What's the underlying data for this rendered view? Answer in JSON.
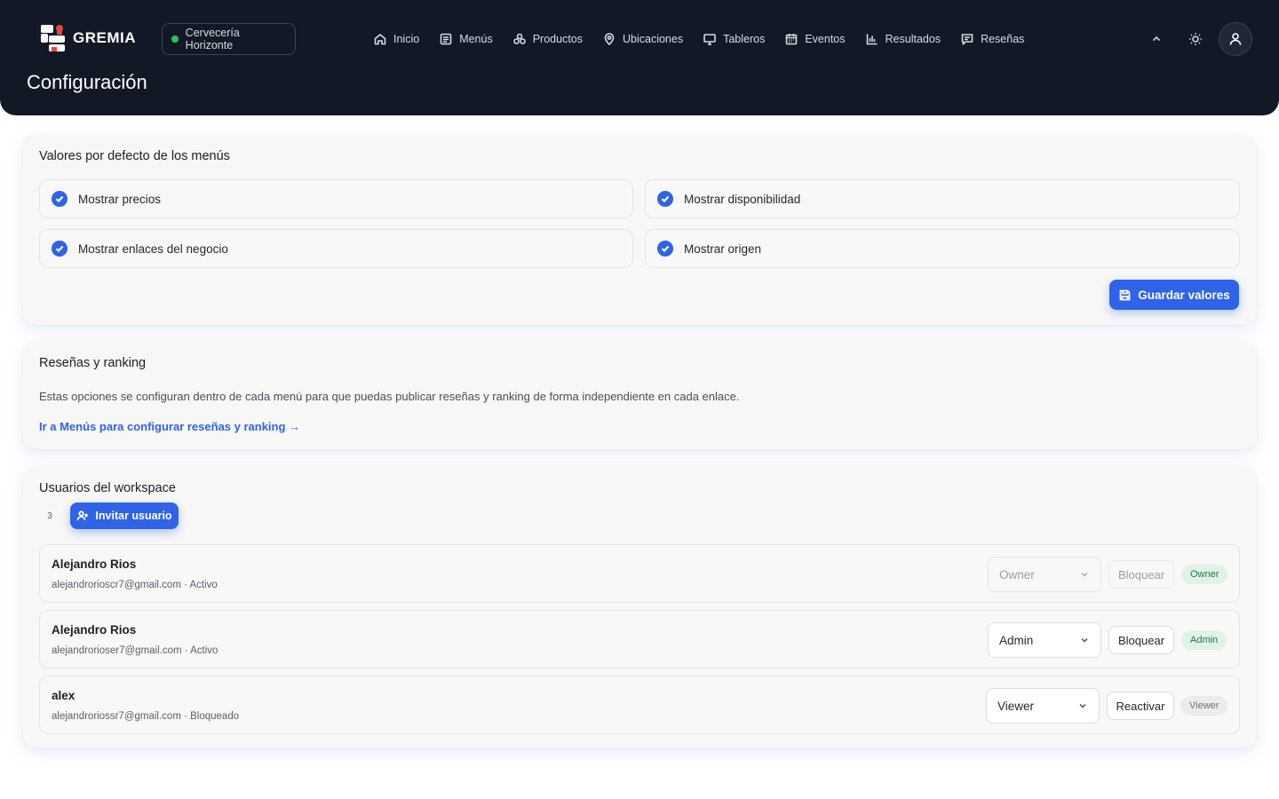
{
  "brand": {
    "name": "GREMIA"
  },
  "workspace": {
    "name": "Cervecería Horizonte"
  },
  "nav": [
    {
      "label": "Inicio",
      "icon": "home-icon"
    },
    {
      "label": "Menús",
      "icon": "menu-doc-icon"
    },
    {
      "label": "Productos",
      "icon": "products-icon"
    },
    {
      "label": "Ubicaciones",
      "icon": "location-pin-icon"
    },
    {
      "label": "Tableros",
      "icon": "monitor-icon"
    },
    {
      "label": "Eventos",
      "icon": "calendar-icon"
    },
    {
      "label": "Resultados",
      "icon": "bar-chart-icon"
    },
    {
      "label": "Reseñas",
      "icon": "review-icon"
    }
  ],
  "page": {
    "title": "Configuración"
  },
  "menu_defaults": {
    "title": "Valores por defecto de los menús",
    "options": [
      {
        "label": "Mostrar precios",
        "checked": true
      },
      {
        "label": "Mostrar disponibilidad",
        "checked": true
      },
      {
        "label": "Mostrar enlaces del negocio",
        "checked": true
      },
      {
        "label": "Mostrar origen",
        "checked": true
      }
    ],
    "save_label": "Guardar valores"
  },
  "reviews": {
    "title": "Reseñas y ranking",
    "description": "Estas opciones se configuran dentro de cada menú para que puedas publicar reseñas y ranking de forma independiente en cada enlace.",
    "link": "Ir a Menús para configurar reseñas y ranking →"
  },
  "users": {
    "title": "Usuarios del workspace",
    "count": "3",
    "invite_label": "Invitar usuario",
    "rows": [
      {
        "name": "Alejandro Rios",
        "meta": "alejandrorioscr7@gmail.com · Activo",
        "role": "Owner",
        "action": "Bloquear",
        "badge": "Owner",
        "disabled": true
      },
      {
        "name": "Alejandro Rios",
        "meta": "alejandrorioser7@gmail.com · Activo",
        "role": "Admin",
        "action": "Bloquear",
        "badge": "Admin",
        "disabled": false
      },
      {
        "name": "alex",
        "meta": "alejandroriossr7@gmail.com · Bloqueado",
        "role": "Viewer",
        "action": "Reactivar",
        "badge": "Viewer",
        "disabled": false
      }
    ]
  },
  "colors": {
    "header_bg": "#121826",
    "accent": "#2f63e8",
    "status_active": "#22c55e",
    "badge_green_bg": "#dff3e6",
    "badge_green_text": "#1f7a45",
    "badge_gray_bg": "#ececee",
    "badge_gray_text": "#6b707a"
  }
}
